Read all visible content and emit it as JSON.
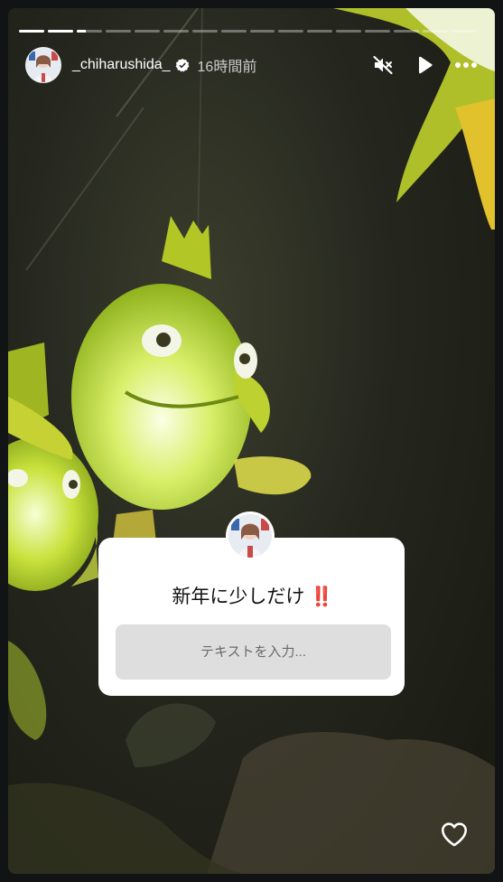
{
  "progress": {
    "segments": 16,
    "current_index": 2,
    "current_fraction": 0.35
  },
  "header": {
    "username": "_chiharushida_",
    "verified": true,
    "timestamp": "16時間前"
  },
  "controls": {
    "mute_icon": "speaker-muted-icon",
    "play_icon": "play-icon",
    "more_icon": "more-horizontal-icon"
  },
  "sticker": {
    "question": "新年に少しだけ",
    "emoji": "‼️",
    "input_placeholder": "テキストを入力..."
  },
  "footer": {
    "like_icon": "heart-outline-icon"
  }
}
